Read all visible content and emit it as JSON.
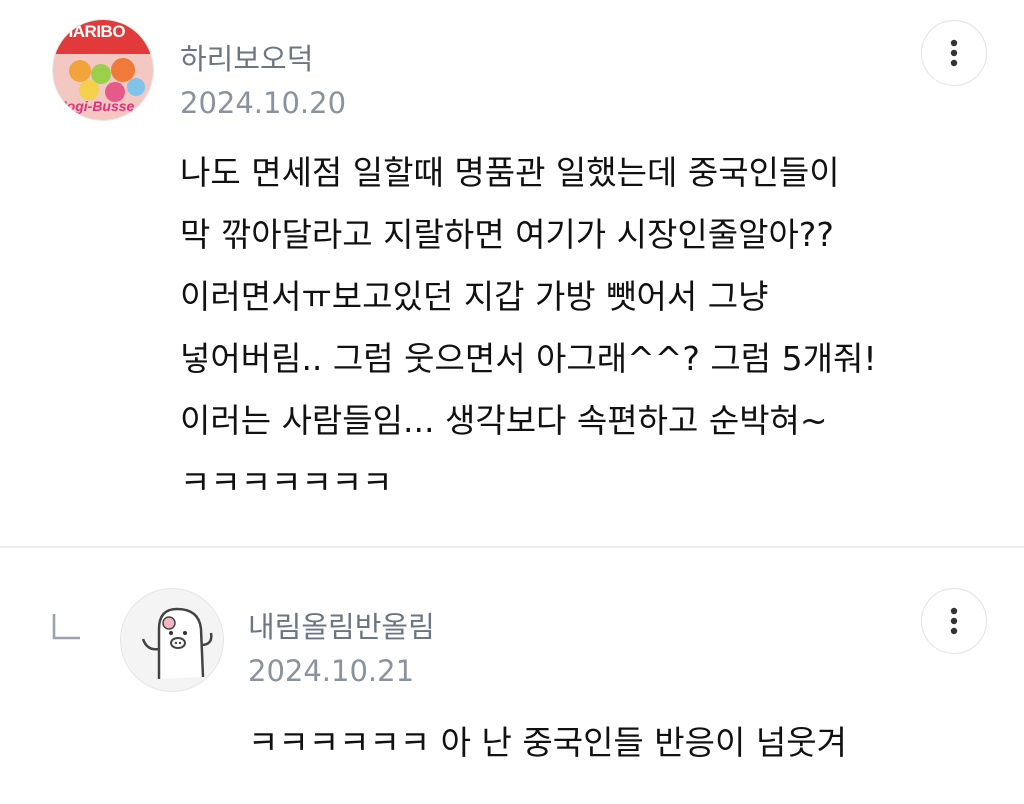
{
  "comments": [
    {
      "nickname": "하리보오덕",
      "date": "2024.10.20",
      "avatar_icon": "haribo-candy-bag",
      "avatar_text_top": "HARIBO",
      "avatar_text_bottom": "Mogi-Busse",
      "more_icon": "vertical-ellipsis-icon",
      "text": "나도 면세점 일할때 명품관 일했는데 중국인들이\n막 깎아달라고 지랄하면 여기가 시장인줄알아??\n이러면서ㅠ보고있던 지갑 가방 뺏어서 그냥\n넣어버림.. 그럼 웃으면서 아그래^^? 그럼 5개줘!\n이러는 사람들임... 생각보다 속편하고 순박혀~\nㅋㅋㅋㅋㅋㅋㅋ"
    },
    {
      "nickname": "내림올림반올림",
      "date": "2024.10.21",
      "avatar_icon": "penguin-character",
      "more_icon": "vertical-ellipsis-icon",
      "reply_icon": "reply-arrow-icon",
      "text": "ㅋㅋㅋㅋㅋㅋ 아 난 중국인들 반응이 넘웃겨"
    }
  ],
  "colors": {
    "nickname": "#6b7682",
    "date": "#8a939d",
    "divider": "#ececec",
    "text": "#111111"
  }
}
